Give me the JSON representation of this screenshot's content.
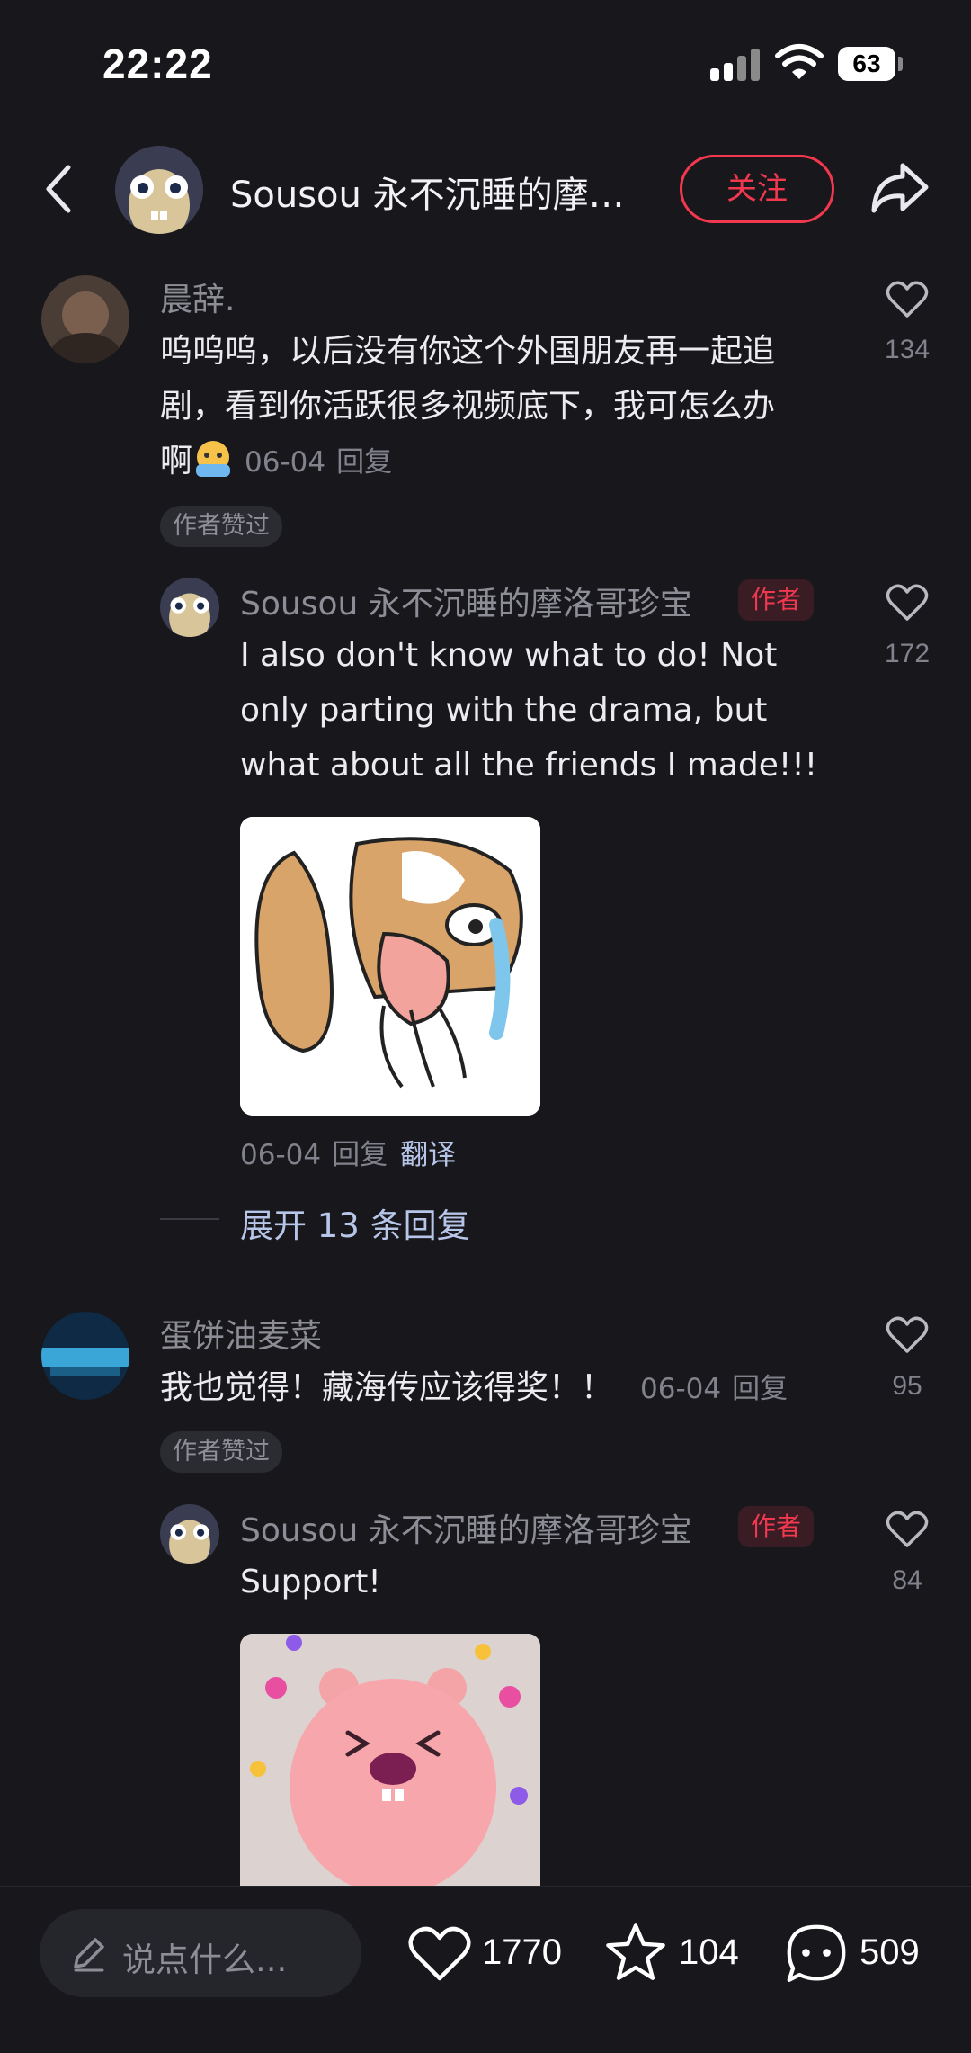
{
  "status": {
    "time": "22:22",
    "battery": "63"
  },
  "header": {
    "title": "Sousou 永不沉睡的摩…",
    "follow_label": "关注"
  },
  "comments": [
    {
      "name": "晨辞.",
      "text_line1": "呜呜呜，以后没有你这个外国朋友再一起追",
      "text_line2": "剧，看到你活跃很多视频底下，我可怎么办",
      "text_line3": "啊",
      "date": "06-04",
      "reply_label": "回复",
      "author_liked": "作者赞过",
      "likes": "134"
    },
    {
      "name": "蛋饼油麦菜",
      "text": "我也觉得！藏海传应该得奖！！",
      "date": "06-04",
      "reply_label": "回复",
      "author_liked": "作者赞过",
      "likes": "95"
    }
  ],
  "replies": [
    {
      "name": "Sousou 永不沉睡的摩洛哥珍宝",
      "tag": "作者",
      "text_line1": "I also don't know what to do! Not",
      "text_line2": "only parting with the drama, but",
      "text_line3": "what about all the friends I made!!!",
      "date": "06-04",
      "reply_label": "回复",
      "translate_label": "翻译",
      "likes": "172",
      "expand_label": "展开 13 条回复"
    },
    {
      "name": "Sousou 永不沉睡的摩洛哥珍宝",
      "tag": "作者",
      "text": "Support!",
      "likes": "84"
    }
  ],
  "bottom_bar": {
    "input_placeholder": "说点什么...",
    "likes": "1770",
    "favorites": "104",
    "comments": "509"
  },
  "colors": {
    "background": "#17171c",
    "accent_red": "#f2384f",
    "link_blue": "#b7c6e8",
    "muted": "#82828c"
  },
  "icons": [
    "back-arrow-icon",
    "share-icon",
    "heart-icon",
    "star-icon",
    "comment-icon",
    "pen-icon",
    "wifi-icon",
    "signal-icon"
  ]
}
